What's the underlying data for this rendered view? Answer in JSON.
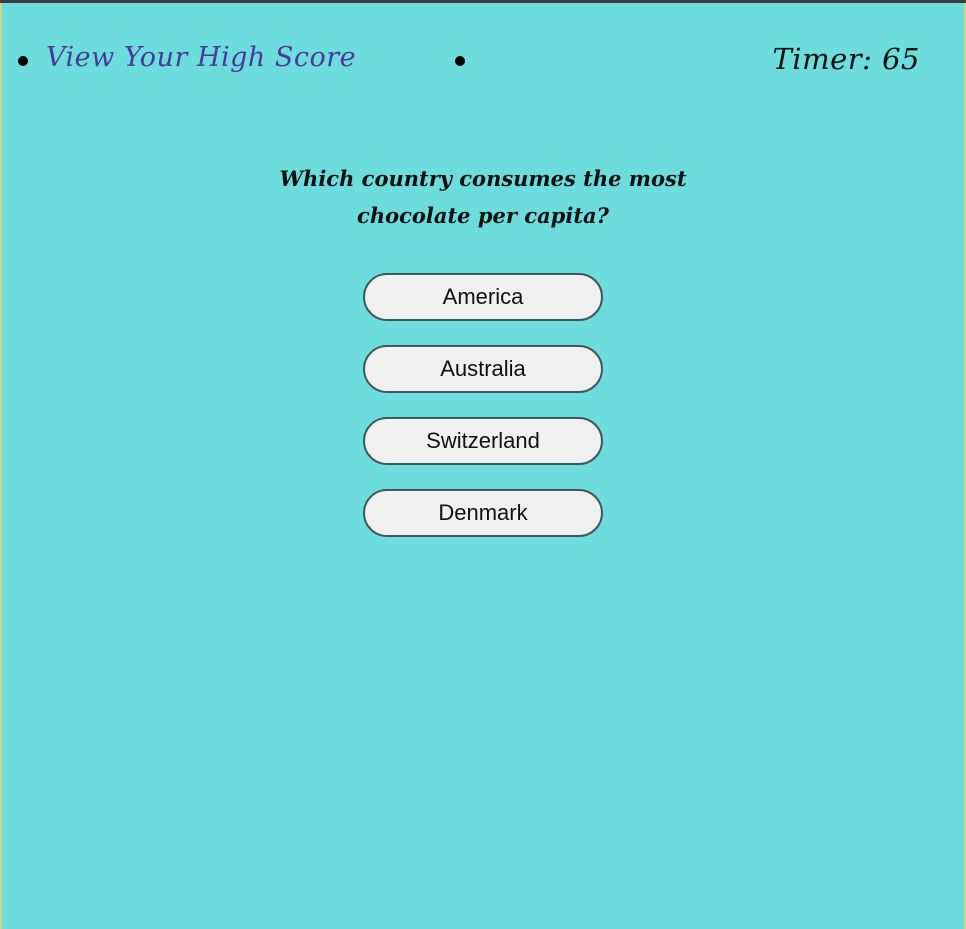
{
  "nav": {
    "highscore_link": "View Your High Score",
    "timer_label": "Timer:",
    "timer_value": "65"
  },
  "quiz": {
    "question": "Which country consumes the most chocolate per capita?",
    "answers": [
      "America",
      "Australia",
      "Switzerland",
      "Denmark"
    ]
  },
  "colors": {
    "background": "#6cdcdd",
    "link": "#4a3a9a",
    "button_bg": "#f0f0f0",
    "button_border": "#3f5a5c"
  }
}
